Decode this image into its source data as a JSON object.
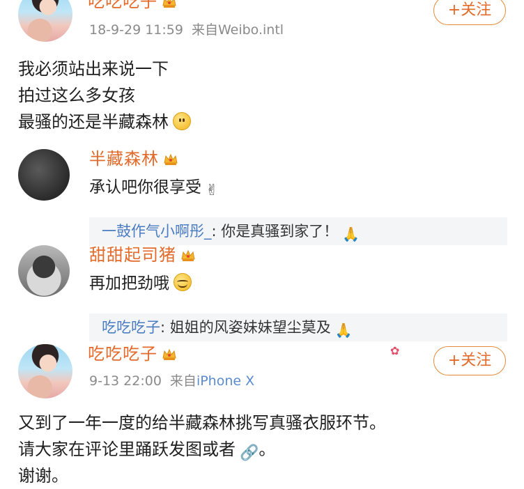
{
  "post1": {
    "username": "吃吃吃子",
    "time": "18-9-29 11:59",
    "source_prefix": "来自",
    "source": "Weibo.intl",
    "follow_label": "+关注",
    "lines": [
      "我必须站出来说一下",
      "拍过这么多女孩",
      "最骚的还是半藏森林"
    ]
  },
  "comments": [
    {
      "username": "半藏森林",
      "text": "承认吧你很享受",
      "reply_user": "一鼓作气小啊彤_",
      "reply_text": ": 你是真骚到家了！"
    },
    {
      "username": "甜甜起司猪",
      "text": "再加把劲哦",
      "reply_user": "吃吃吃子",
      "reply_text": ": 姐姐的风姿妹妹望尘莫及"
    }
  ],
  "post2": {
    "username": "吃吃吃子",
    "time": "9-13 22:00",
    "source_prefix": "来自",
    "source": "iPhone X",
    "follow_label": "+关注",
    "lines": [
      "又到了一年一度的给半藏森林挑写真骚衣服环节。",
      "请大家在评论里踊跃发图或者",
      "。",
      "谢谢。"
    ]
  },
  "icons": {
    "crown": "vip-crown-icon",
    "smile": "smile-emoji-icon",
    "heart_hand": "finger-heart-emoji-icon",
    "pray": "praying-hands-emoji-icon",
    "blush": "blush-emoji-icon",
    "link": "link-chain-icon"
  },
  "colors": {
    "username": "#e26a2a",
    "reply_user": "#4a7cc2",
    "meta": "#8a8a8a",
    "follow_border": "#e58a3a"
  }
}
